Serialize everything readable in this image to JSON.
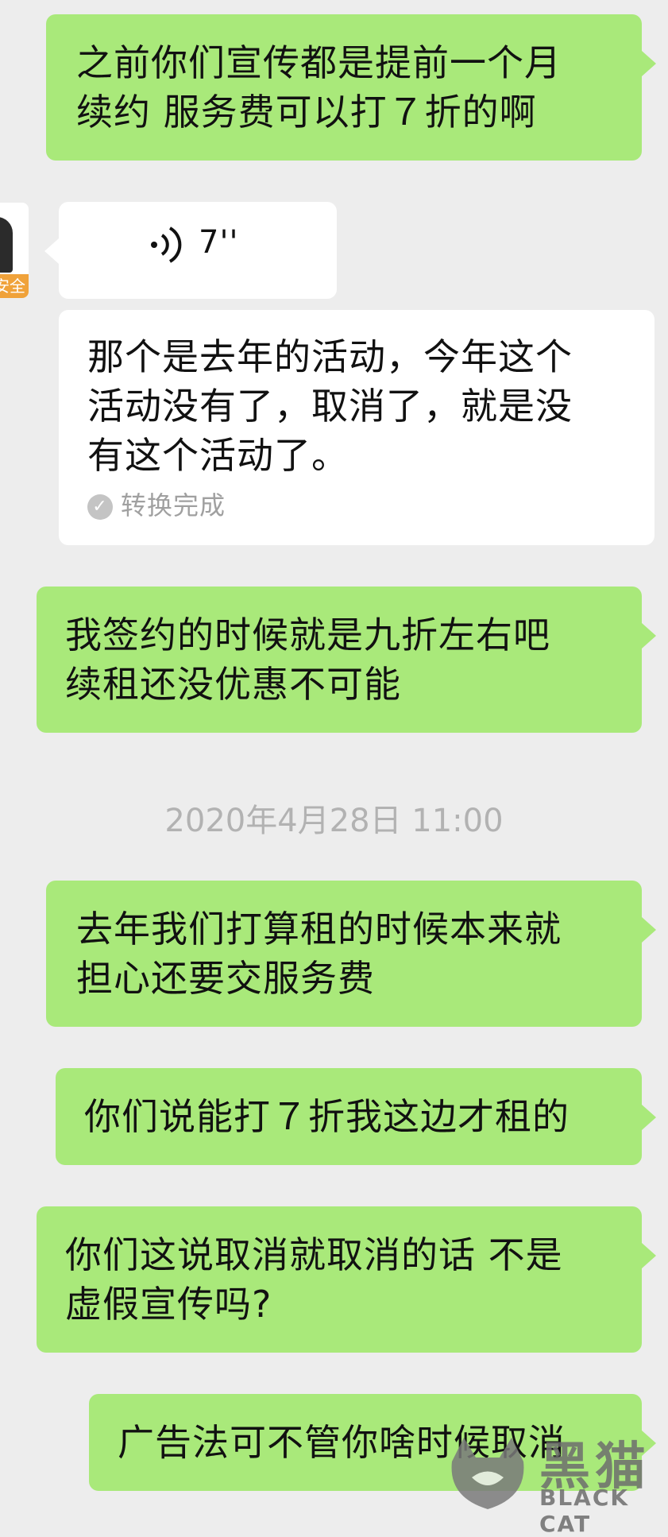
{
  "messages": [
    {
      "id": "m1",
      "side": "right",
      "lines": [
        "之前你们宣传都是提前一个月",
        "续约 服务费可以打７折的啊"
      ]
    },
    {
      "id": "m2",
      "side": "left",
      "type": "voice",
      "duration": "7''"
    },
    {
      "id": "m3",
      "side": "left",
      "lines": [
        "那个是去年的活动，今年这个",
        "活动没有了，取消了，就是没",
        "有这个活动了。"
      ],
      "status": "转换完成"
    },
    {
      "id": "m4",
      "side": "right",
      "lines": [
        "我签约的时候就是九折左右吧",
        "续租还没优惠不可能"
      ]
    },
    {
      "id": "m5",
      "side": "right",
      "lines": [
        "去年我们打算租的时候本来就",
        "担心还要交服务费"
      ]
    },
    {
      "id": "m6",
      "side": "right",
      "lines": [
        "你们说能打７折我这边才租的"
      ]
    },
    {
      "id": "m7",
      "side": "right",
      "lines": [
        "你们这说取消就取消的话 不是",
        "虚假宣传吗?"
      ]
    },
    {
      "id": "m8",
      "side": "right",
      "lines": [
        "广告法可不管你啥时候取消"
      ]
    }
  ],
  "timestamp": "2020年4月28日 11:00",
  "avatar_badge": "安全",
  "watermark": {
    "cn": "黑猫",
    "en": "BLACK CAT"
  },
  "colors": {
    "outgoing": "#a9e97a",
    "incoming": "#ffffff",
    "background": "#ededed"
  }
}
